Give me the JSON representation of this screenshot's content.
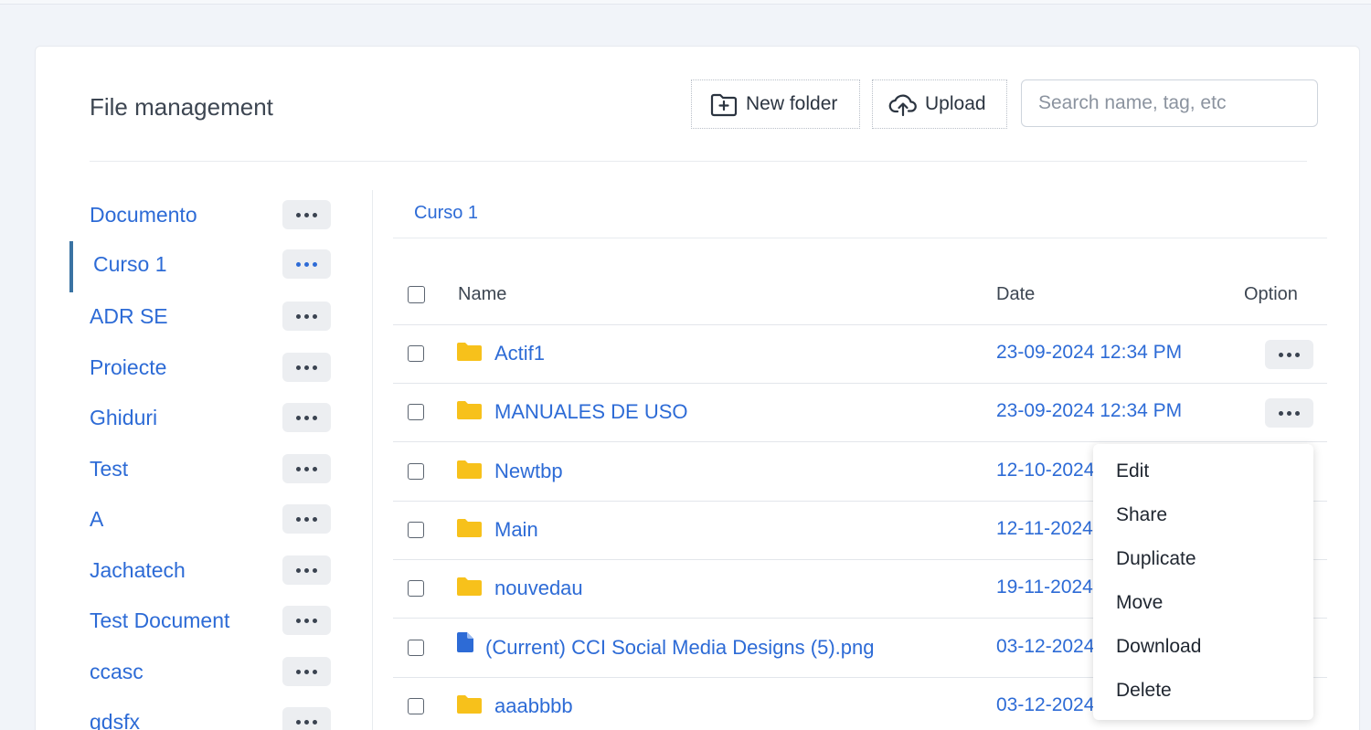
{
  "header": {
    "title": "File management",
    "new_folder_label": "New folder",
    "upload_label": "Upload",
    "search_placeholder": "Search name, tag, etc"
  },
  "sidebar": {
    "items": [
      {
        "label": "Documento"
      },
      {
        "label": "Curso 1",
        "active": true
      },
      {
        "label": "ADR SE"
      },
      {
        "label": "Proiecte"
      },
      {
        "label": "Ghiduri"
      },
      {
        "label": "Test"
      },
      {
        "label": "A"
      },
      {
        "label": "Jachatech"
      },
      {
        "label": "Test Document"
      },
      {
        "label": "ccasc"
      },
      {
        "label": "gdsfx"
      }
    ]
  },
  "breadcrumb": "Curso 1",
  "table": {
    "columns": [
      "Name",
      "Date",
      "Option"
    ],
    "rows": [
      {
        "type": "folder",
        "name": "Actif1",
        "date": "23-09-2024 12:34 PM"
      },
      {
        "type": "folder",
        "name": "MANUALES DE USO",
        "date": "23-09-2024 12:34 PM"
      },
      {
        "type": "folder",
        "name": "Newtbp",
        "date": "12-10-2024"
      },
      {
        "type": "folder",
        "name": "Main",
        "date": "12-11-2024"
      },
      {
        "type": "folder",
        "name": "nouvedau",
        "date": "19-11-2024"
      },
      {
        "type": "file",
        "name": "(Current) CCI Social Media Designs (5).png",
        "date": "03-12-2024"
      },
      {
        "type": "folder",
        "name": "aaabbbb",
        "date": "03-12-2024"
      }
    ]
  },
  "context_menu": {
    "items": [
      "Edit",
      "Share",
      "Duplicate",
      "Move",
      "Download",
      "Delete"
    ]
  },
  "colors": {
    "accent": "#2d6bd6",
    "folder": "#f7c11b",
    "active_bar": "#3a73a3"
  }
}
